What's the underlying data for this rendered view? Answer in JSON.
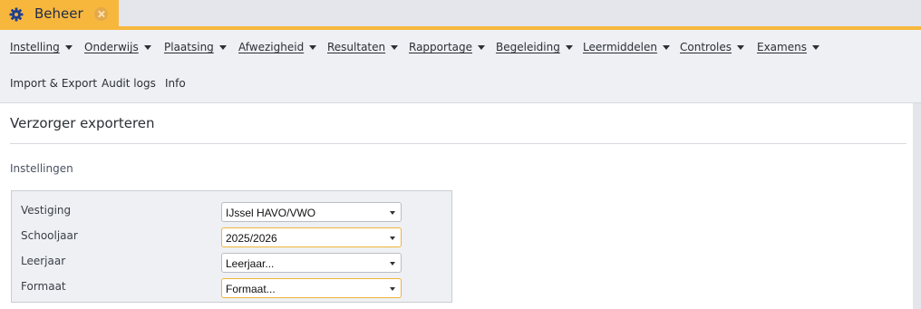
{
  "tab": {
    "icon": "gear-icon",
    "title": "Beheer",
    "close_icon": "close-circle-icon",
    "accent_color": "#f7b73d"
  },
  "menu": {
    "row1": [
      {
        "label": "Instelling",
        "has_dropdown": true
      },
      {
        "label": "Onderwijs",
        "has_dropdown": true
      },
      {
        "label": "Plaatsing",
        "has_dropdown": true
      },
      {
        "label": "Afwezigheid",
        "has_dropdown": true
      },
      {
        "label": "Resultaten",
        "has_dropdown": true
      },
      {
        "label": "Rapportage",
        "has_dropdown": true
      },
      {
        "label": "Begeleiding",
        "has_dropdown": true
      },
      {
        "label": "Leermiddelen",
        "has_dropdown": true
      },
      {
        "label": "Controles",
        "has_dropdown": true
      },
      {
        "label": "Examens",
        "has_dropdown": true
      }
    ],
    "row2": [
      {
        "label": "Import & Export"
      },
      {
        "label": "Audit logs"
      },
      {
        "label": "Info"
      }
    ]
  },
  "page": {
    "title": "Verzorger exporteren",
    "section_title": "Instellingen"
  },
  "form": {
    "fields": [
      {
        "label": "Vestiging",
        "value": "IJssel HAVO/VWO",
        "focused": false
      },
      {
        "label": "Schooljaar",
        "value": "2025/2026",
        "focused": true
      },
      {
        "label": "Leerjaar",
        "value": "Leerjaar...",
        "focused": false
      },
      {
        "label": "Formaat",
        "value": "Formaat...",
        "focused": true
      }
    ]
  }
}
